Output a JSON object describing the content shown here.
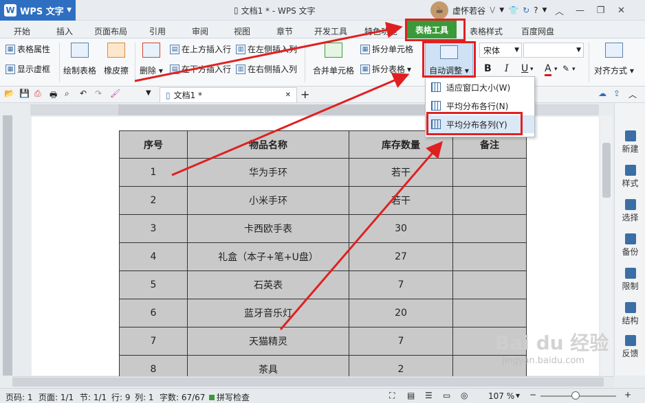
{
  "app": {
    "name": "WPS 文字",
    "logo_letter": "W",
    "doc_title": "文档1 * - WPS 文字",
    "user": "虚怀若谷",
    "user_badge": "V",
    "help": "?"
  },
  "menu": {
    "tabs": [
      "开始",
      "插入",
      "页面布局",
      "引用",
      "审阅",
      "视图",
      "章节",
      "开发工具",
      "特色功能",
      "表格工具",
      "表格样式",
      "百度网盘"
    ],
    "active": "表格工具"
  },
  "ribbon": {
    "table_props": "表格属性",
    "show_grid": "显示虚框",
    "draw_table": "绘制表格",
    "eraser": "橡皮擦",
    "delete": "删除",
    "insert_above": "在上方插入行",
    "insert_below": "在下方插入行",
    "insert_left": "在左侧插入列",
    "insert_right": "在右侧插入列",
    "merge": "合并单元格",
    "split_cell": "拆分单元格",
    "split_table": "拆分表格",
    "auto_fit": "自动调整",
    "font": "宋体",
    "bold": "B",
    "italic": "I",
    "underline": "U",
    "align": "对齐方式"
  },
  "doc_tab": {
    "name": "文档1 *"
  },
  "dropdown": {
    "items": [
      "适应窗口大小(W)",
      "平均分布各行(N)",
      "平均分布各列(Y)"
    ],
    "highlighted": "平均分布各列(Y)"
  },
  "table": {
    "headers": [
      "序号",
      "物品名称",
      "库存数量",
      "备注"
    ],
    "rows": [
      [
        "1",
        "华为手环",
        "若干",
        ""
      ],
      [
        "2",
        "小米手环",
        "若干",
        ""
      ],
      [
        "3",
        "卡西欧手表",
        "30",
        ""
      ],
      [
        "4",
        "礼盒（本子+笔+U盘）",
        "27",
        ""
      ],
      [
        "5",
        "石英表",
        "7",
        ""
      ],
      [
        "6",
        "蓝牙音乐灯",
        "20",
        ""
      ],
      [
        "7",
        "天猫精灵",
        "7",
        ""
      ],
      [
        "8",
        "茶具",
        "2",
        ""
      ]
    ]
  },
  "right_panel": [
    "新建",
    "样式",
    "选择",
    "备份",
    "限制",
    "结构",
    "反馈"
  ],
  "status": {
    "page_code": "页码: 1",
    "pages": "页面: 1/1",
    "section": "节: 1/1",
    "row": "行: 9",
    "col": "列: 1",
    "words": "字数: 67/67",
    "spell": "拼写检查",
    "zoom": "107 %"
  },
  "watermark": {
    "text": "Bai du 经验",
    "url": "jingyan.baidu.com"
  },
  "colors": {
    "active_tab": "#3a9a3a",
    "highlight": "#e02020",
    "app_blue": "#2e6fc2"
  }
}
